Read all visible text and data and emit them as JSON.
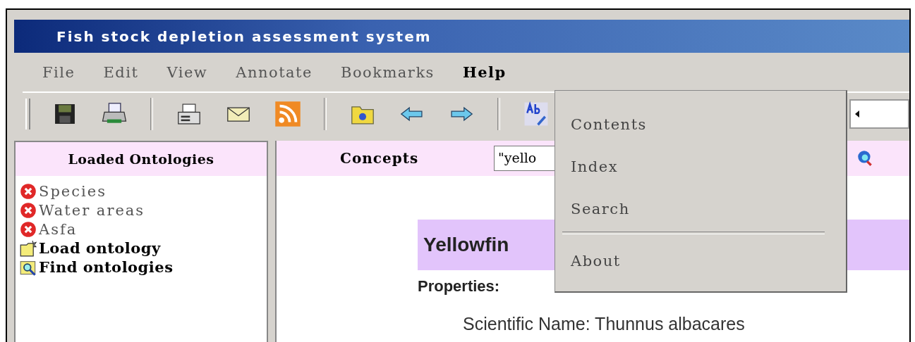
{
  "window": {
    "title": "Fish stock depletion assessment system"
  },
  "menu": [
    {
      "label": "File",
      "open": false
    },
    {
      "label": "Edit",
      "open": false
    },
    {
      "label": "View",
      "open": false
    },
    {
      "label": "Annotate",
      "open": false
    },
    {
      "label": "Bookmarks",
      "open": false
    },
    {
      "label": "Help",
      "open": true
    }
  ],
  "help_menu": [
    {
      "kind": "item",
      "label": "Contents"
    },
    {
      "kind": "item",
      "label": "Index"
    },
    {
      "kind": "item",
      "label": "Search"
    },
    {
      "kind": "separator"
    },
    {
      "kind": "item",
      "label": "About"
    }
  ],
  "ontologies": {
    "title": "Loaded Ontologies",
    "items": [
      {
        "kind": "loaded",
        "label": "Species"
      },
      {
        "kind": "loaded",
        "label": "Water areas"
      },
      {
        "kind": "loaded",
        "label": "Asfa"
      },
      {
        "kind": "load",
        "label": "Load ontology"
      },
      {
        "kind": "find",
        "label": "Find ontologies"
      }
    ]
  },
  "concepts": {
    "title": "Concepts",
    "search": {
      "value": "\"yello"
    }
  },
  "concept": {
    "name": "Yellowfin",
    "properties_label": "Properties:",
    "properties": [
      {
        "text": "Scientific Name: Thunnus albacares"
      }
    ]
  }
}
